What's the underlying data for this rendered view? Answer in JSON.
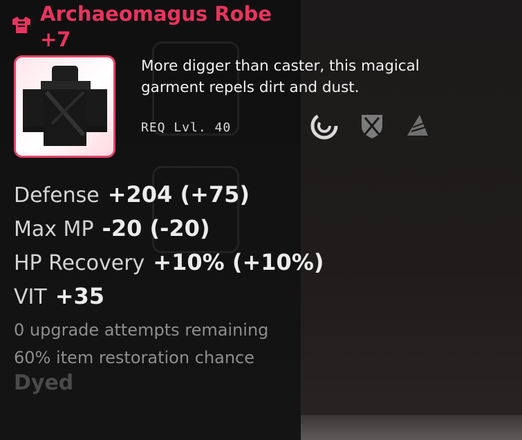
{
  "item": {
    "name": "Archaeomagus Robe",
    "upgrade": "+7",
    "slot_icon": "armor-chestplate-icon",
    "image_icon": "black-robe-icon",
    "description_lines": [
      "More digger than caster, this magical",
      "garment repels dirt and dust."
    ],
    "requirement": "REQ Lvl. 40",
    "class_icons": [
      "mage-swirl-icon",
      "warrior-shield-icon",
      "sail-icon"
    ]
  },
  "stats": [
    {
      "name": "Defense",
      "value": "+204 (+75)"
    },
    {
      "name": "Max MP",
      "value": "-20 (-20)"
    },
    {
      "name": "HP Recovery",
      "value": "+10% (+10%)"
    },
    {
      "name": "VIT",
      "value": "+35"
    }
  ],
  "notes": {
    "upgrade_attempts": "0 upgrade attempts remaining",
    "restoration_chance": "60% item restoration chance",
    "dyed": "Dyed"
  },
  "colors": {
    "title": "#e8345e",
    "frame_border": "#e6456c",
    "text": "#f2f2f2",
    "stat_name": "#d4d4d4",
    "note": "#8e8e8e"
  }
}
